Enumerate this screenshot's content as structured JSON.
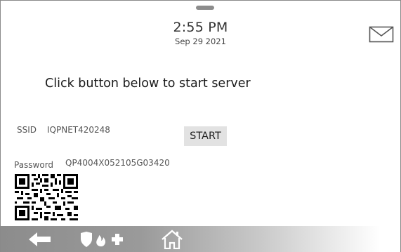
{
  "status": {
    "time": "2:55 PM",
    "date": "Sep 29 2021"
  },
  "main": {
    "headline": "Click button below to start server",
    "ssid_label": "SSID",
    "ssid_value": "IQPNET420248",
    "password_label": "Password",
    "password_value": "QP4004X052105G03420",
    "start_button": "START"
  },
  "icons": {
    "mail": "envelope-icon",
    "qr": "qr-code",
    "back": "back-arrow-icon",
    "emergency": "shield-fire-medical-icon",
    "home": "home-icon"
  },
  "colors": {
    "button_bg": "#e2e2e2",
    "navbar_start": "#8c8c8c",
    "navbar_end": "#ffffff",
    "text_muted": "#555555"
  }
}
